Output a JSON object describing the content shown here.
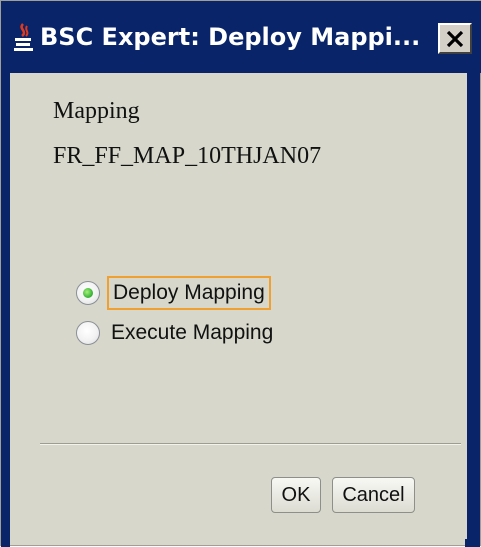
{
  "window": {
    "title": "BSC Expert: Deploy Mappi...",
    "close_symbol": "✕",
    "icon": "java-cup-icon"
  },
  "mapping": {
    "heading": "Mapping",
    "name": "FR_FF_MAP_10THJAN07"
  },
  "options": [
    {
      "label": "Deploy Mapping",
      "selected": true
    },
    {
      "label": "Execute Mapping",
      "selected": false
    }
  ],
  "buttons": {
    "ok_label": "OK",
    "cancel_label": "Cancel"
  },
  "colors": {
    "titlebar": "#0a246a",
    "dialog_bg": "#d7d8cb",
    "focus_ring": "#f0a030",
    "radio_selected": "#3fb83a"
  }
}
